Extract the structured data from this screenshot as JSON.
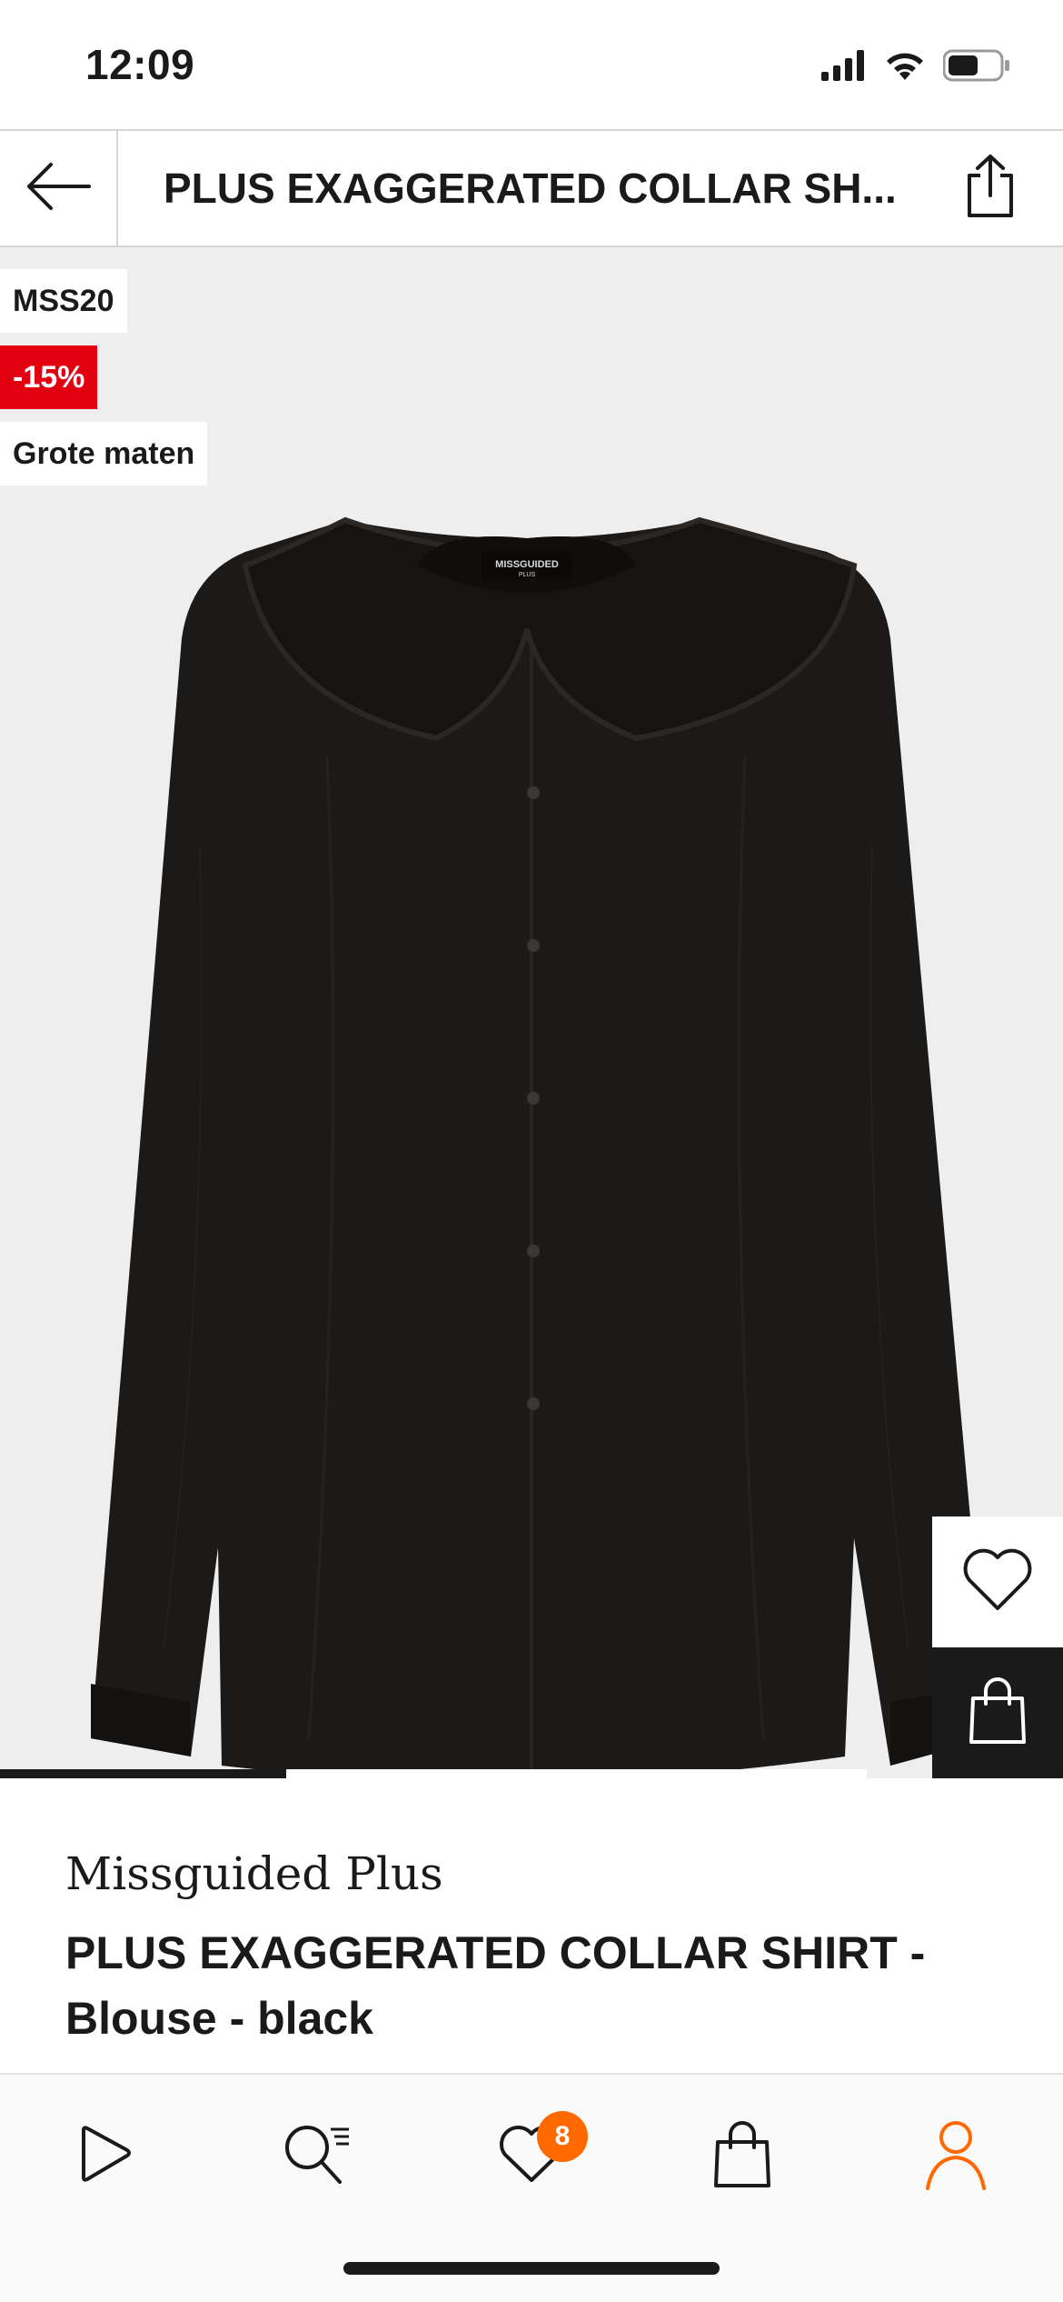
{
  "status_bar": {
    "time": "12:09",
    "icons": [
      "signal-icon",
      "wifi-icon",
      "battery-icon"
    ]
  },
  "header": {
    "title": "PLUS EXAGGERATED COLLAR SH...",
    "back_icon": "arrow-left-icon",
    "share_icon": "share-icon"
  },
  "product_image": {
    "badges": {
      "code": "MSS20",
      "discount": "-15%",
      "size": "Grote maten"
    },
    "label_brand": "MISSGUIDED",
    "label_sub": "PLUS",
    "gallery_progress": 0.33,
    "wishlist_icon": "heart-icon",
    "add_to_bag_icon": "bag-icon"
  },
  "product_info": {
    "brand": "Missguided Plus",
    "name": "PLUS EXAGGERATED COLLAR SHIRT - Blouse - black"
  },
  "bottom_nav": {
    "items": [
      {
        "name": "home",
        "icon": "home-icon"
      },
      {
        "name": "search",
        "icon": "search-icon"
      },
      {
        "name": "wishlist",
        "icon": "heart-icon",
        "badge": "8"
      },
      {
        "name": "bag",
        "icon": "bag-icon"
      },
      {
        "name": "account",
        "icon": "user-icon"
      }
    ]
  },
  "colors": {
    "accent": "#ff6900",
    "discount": "#e0000f",
    "text": "#1a1a1a",
    "image_bg": "#eeeeee"
  }
}
